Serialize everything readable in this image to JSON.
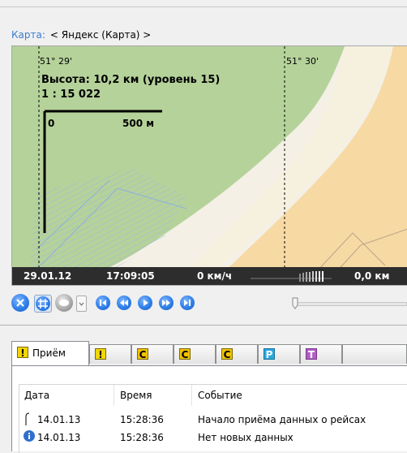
{
  "map": {
    "label": "Карта:",
    "source": "< Яндекс (Карта) >",
    "coord_left": "51° 29'",
    "coord_right": "51° 30'",
    "altitude": "Высота: 10,2 км (уровень 15)",
    "scale_ratio": "1 : 15 022",
    "scalebar_zero": "0",
    "scalebar_distance": "500 м"
  },
  "status": {
    "date": "29.01.12",
    "time": "17:09:05",
    "speed": "0 км/ч",
    "distance": "0,0 км"
  },
  "toolbar": {
    "buttons": [
      "close-icon",
      "grid-icon",
      "layers-icon",
      "dropdown-icon",
      "first-icon",
      "rewind-icon",
      "play-icon",
      "forward-icon",
      "last-icon"
    ]
  },
  "tabs": [
    {
      "badge": "!",
      "label": "Приём",
      "color": "#f2d600"
    },
    {
      "badge": "!",
      "label": "",
      "color": "#f2d600"
    },
    {
      "badge": "C",
      "label": "",
      "color": "#f2c200"
    },
    {
      "badge": "C",
      "label": "",
      "color": "#f2c200"
    },
    {
      "badge": "C",
      "label": "",
      "color": "#f2c200"
    },
    {
      "badge": "P",
      "label": "",
      "color": "#29a8e0"
    },
    {
      "badge": "T",
      "label": "",
      "color": "#b35cc6"
    }
  ],
  "table": {
    "columns": [
      "Дата",
      "Время",
      "Событие"
    ],
    "rows": [
      {
        "date": "14.01.13",
        "time": "15:28:36",
        "event": "Начало приёма данных о рейсах"
      },
      {
        "date": "14.01.13",
        "time": "15:28:36",
        "event": "Нет новых данных"
      }
    ]
  }
}
